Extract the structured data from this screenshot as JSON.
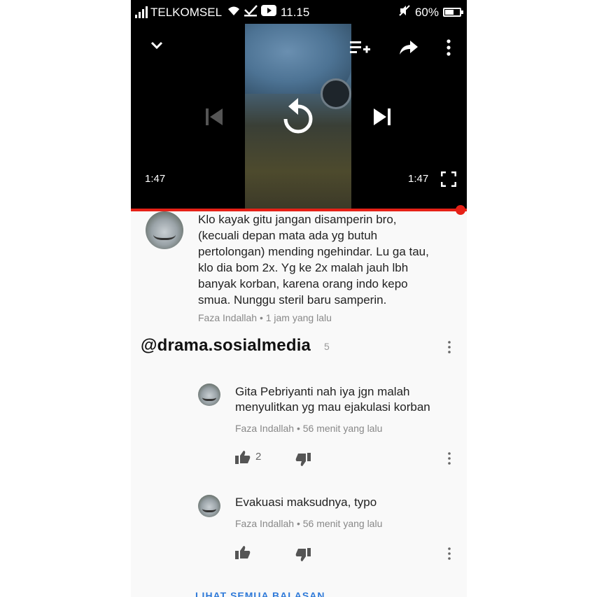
{
  "status_bar": {
    "carrier": "TELKOMSEL",
    "time": "11.15",
    "battery": "60%",
    "battery_level": 0.6
  },
  "player": {
    "current_time": "1:47",
    "duration": "1:47",
    "progress": 1.0,
    "icons": [
      "chevron-down-icon",
      "add-to-playlist-icon",
      "share-icon",
      "more-vert-icon",
      "previous-icon",
      "replay-icon",
      "next-icon",
      "fullscreen-icon"
    ]
  },
  "comment": {
    "lines": [
      "Klo kayak gitu jangan disamperin bro,",
      "(kecuali depan mata ada yg butuh",
      "pertolongan) mending ngehindar. Lu ga tau,",
      "klo dia bom 2x. Yg ke 2x malah jauh lbh",
      "banyak korban, karena orang indo kepo",
      "smua. Nunggu steril baru samperin."
    ],
    "meta": "Faza Indallah • 1 jam yang lalu"
  },
  "watermark": {
    "text": "@drama.sosialmedia",
    "suffix": "5"
  },
  "replies": [
    {
      "lines": [
        "Gita Pebriyanti nah iya jgn malah",
        "menyulitkan yg mau ejakulasi korban"
      ],
      "meta": "Faza Indallah • 56 menit yang lalu",
      "likes": "2"
    },
    {
      "lines": [
        "Evakuasi maksudnya, typo"
      ],
      "meta": "Faza Indallah • 56 menit yang lalu",
      "likes": ""
    }
  ],
  "view_all_label": "LIHAT SEMUA BALASAN"
}
